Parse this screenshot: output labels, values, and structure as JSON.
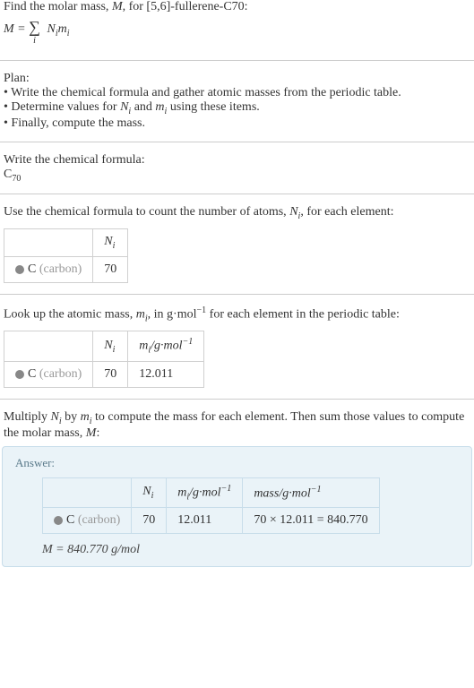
{
  "intro": {
    "line1_prefix": "Find the molar mass, ",
    "line1_var": "M",
    "line1_mid": ", for [5,6]-fullerene-C70:",
    "formula_lhs": "M",
    "formula_eq": " = ",
    "formula_sum": "∑",
    "formula_index": "i",
    "formula_rhs1": "N",
    "formula_rhs1_sub": "i",
    "formula_rhs2": "m",
    "formula_rhs2_sub": "i"
  },
  "plan": {
    "heading": "Plan:",
    "b1": "• Write the chemical formula and gather atomic masses from the periodic table.",
    "b2_prefix": "• Determine values for ",
    "b2_n": "N",
    "b2_n_sub": "i",
    "b2_and": " and ",
    "b2_m": "m",
    "b2_m_sub": "i",
    "b2_suffix": " using these items.",
    "b3": "• Finally, compute the mass."
  },
  "step1": {
    "heading": "Write the chemical formula:",
    "element": "C",
    "count": "70"
  },
  "step2": {
    "text_prefix": "Use the chemical formula to count the number of atoms, ",
    "n": "N",
    "n_sub": "i",
    "text_suffix": ", for each element:",
    "header_n": "N",
    "header_n_sub": "i",
    "row_element_sym": "C",
    "row_element_name": " (carbon)",
    "row_n": "70"
  },
  "step3": {
    "text_prefix": "Look up the atomic mass, ",
    "m": "m",
    "m_sub": "i",
    "text_mid": ", in g·mol",
    "text_exp": "−1",
    "text_suffix": " for each element in the periodic table:",
    "header_n": "N",
    "header_n_sub": "i",
    "header_m": "m",
    "header_m_sub": "i",
    "header_m_unit": "/g·mol",
    "header_m_exp": "−1",
    "row_element_sym": "C",
    "row_element_name": " (carbon)",
    "row_n": "70",
    "row_m": "12.011"
  },
  "step4": {
    "text_prefix": "Multiply ",
    "n": "N",
    "n_sub": "i",
    "text_by": " by ",
    "m": "m",
    "m_sub": "i",
    "text_mid": " to compute the mass for each element. Then sum those values to compute the molar mass, ",
    "M": "M",
    "text_suffix": ":"
  },
  "answer": {
    "label": "Answer:",
    "header_n": "N",
    "header_n_sub": "i",
    "header_m": "m",
    "header_m_sub": "i",
    "header_m_unit": "/g·mol",
    "header_m_exp": "−1",
    "header_mass": "mass/g·mol",
    "header_mass_exp": "−1",
    "row_element_sym": "C",
    "row_element_name": " (carbon)",
    "row_n": "70",
    "row_m": "12.011",
    "row_calc": "70 × 12.011 = 840.770",
    "final_var": "M",
    "final_eq": " = 840.770 g/mol"
  }
}
